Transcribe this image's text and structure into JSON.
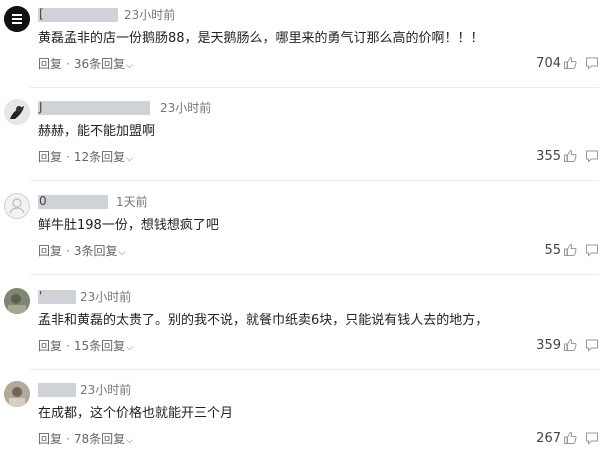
{
  "comments": [
    {
      "name_initial": "[",
      "time": "23小时前",
      "text": "黄磊孟非的店一份鹅肠88，是天鹅肠么，哪里来的勇气订那么高的价啊！！！",
      "reply_label": "回复",
      "replies_label": "36条回复",
      "likes": "704",
      "avatar_icon": "face-avatar"
    },
    {
      "name_initial": "J",
      "time": "23小时前",
      "text": "赫赫，能不能加盟啊",
      "reply_label": "回复",
      "replies_label": "12条回复",
      "likes": "355",
      "avatar_icon": "dark-figure-avatar"
    },
    {
      "name_initial": "0",
      "time": "1天前",
      "text": "鲜牛肚198一份，想钱想疯了吧",
      "reply_label": "回复",
      "replies_label": "3条回复",
      "likes": "55",
      "avatar_icon": "default-avatar"
    },
    {
      "name_initial": "'",
      "time": "23小时前",
      "text": "孟非和黄磊的太贵了。别的我不说，就餐巾纸卖6块，只能说有钱人去的地方，",
      "reply_label": "回复",
      "replies_label": "15条回复",
      "likes": "359",
      "avatar_icon": "photo-avatar"
    },
    {
      "name_initial": "",
      "time": "23小时前",
      "text": "在成都，这个价格也就能开三个月",
      "reply_label": "回复",
      "replies_label": "78条回复",
      "likes": "267",
      "avatar_icon": "photo-avatar-2"
    }
  ],
  "icons": {
    "reply_expand": "chevron-down-icon",
    "like": "thumbs-up-icon",
    "comment": "comment-icon"
  },
  "colors": {
    "masked_name": "#cfd2d6",
    "divider": "#ececec",
    "meta_text": "#777777"
  }
}
